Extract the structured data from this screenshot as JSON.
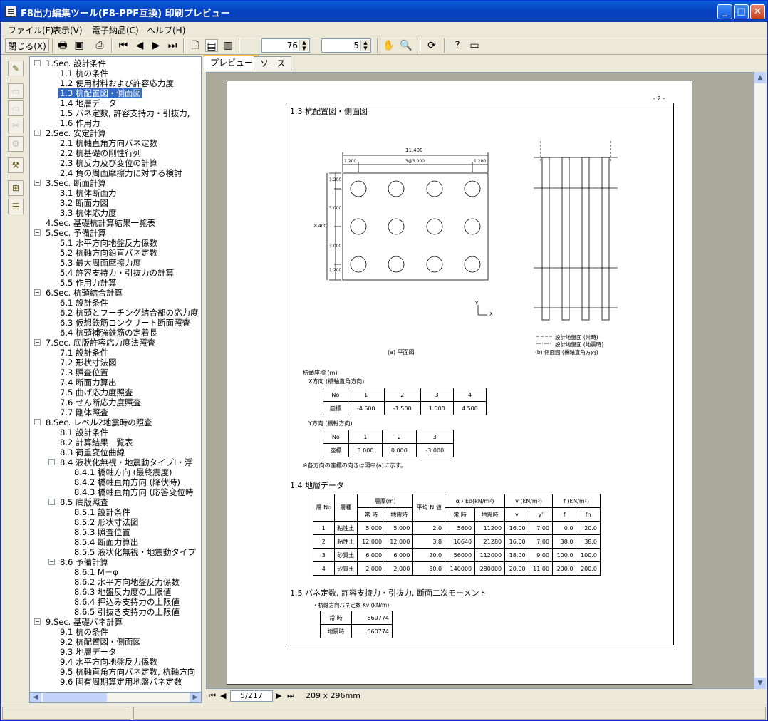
{
  "window": {
    "title": "F8出力編集ツール(F8-PPF互換) 印刷プレビュー",
    "min": "_",
    "max": "□",
    "close": "✕"
  },
  "menu": [
    "ファイル(F)",
    "表示(V)",
    "電子納品(C)",
    "ヘルプ(H)"
  ],
  "toolbar": {
    "close_label": "閉じる(X)",
    "zoom": "76",
    "pages": "5"
  },
  "tree": [
    {
      "t": "1.Sec. 設計条件",
      "l": 0,
      "e": "-"
    },
    {
      "t": "1.1 杭の条件",
      "l": 1
    },
    {
      "t": "1.2 使用材料および許容応力度",
      "l": 1
    },
    {
      "t": "1.3 杭配置図・側面図",
      "l": 1,
      "s": true
    },
    {
      "t": "1.4 地層データ",
      "l": 1
    },
    {
      "t": "1.5 バネ定数, 許容支持力・引抜力,",
      "l": 1
    },
    {
      "t": "1.6 作用力",
      "l": 1
    },
    {
      "t": "2.Sec. 安定計算",
      "l": 0,
      "e": "-"
    },
    {
      "t": "2.1 杭軸直角方向バネ定数",
      "l": 1
    },
    {
      "t": "2.2 杭基礎の剛性行列",
      "l": 1
    },
    {
      "t": "2.3 杭反力及び変位の計算",
      "l": 1
    },
    {
      "t": "2.4 負の周面摩擦力に対する検討",
      "l": 1
    },
    {
      "t": "3.Sec. 断面計算",
      "l": 0,
      "e": "-"
    },
    {
      "t": "3.1 杭体断面力",
      "l": 1
    },
    {
      "t": "3.2 断面力図",
      "l": 1
    },
    {
      "t": "3.3 杭体応力度",
      "l": 1
    },
    {
      "t": "4.Sec. 基礎杭計算結果一覧表",
      "l": 0
    },
    {
      "t": "5.Sec. 予備計算",
      "l": 0,
      "e": "-"
    },
    {
      "t": "5.1 水平方向地盤反力係数",
      "l": 1
    },
    {
      "t": "5.2 杭軸方向鉛直バネ定数",
      "l": 1
    },
    {
      "t": "5.3 最大周面摩擦力度",
      "l": 1
    },
    {
      "t": "5.4 許容支持力・引抜力の計算",
      "l": 1
    },
    {
      "t": "5.5 作用力計算",
      "l": 1
    },
    {
      "t": "6.Sec. 杭頭結合計算",
      "l": 0,
      "e": "-"
    },
    {
      "t": "6.1 設計条件",
      "l": 1
    },
    {
      "t": "6.2 杭頭とフーチング結合部の応力度",
      "l": 1
    },
    {
      "t": "6.3 仮想鉄筋コンクリート断面照査",
      "l": 1
    },
    {
      "t": "6.4 杭頭補強鉄筋の定着長",
      "l": 1
    },
    {
      "t": "7.Sec. 底版許容応力度法照査",
      "l": 0,
      "e": "-"
    },
    {
      "t": "7.1 設計条件",
      "l": 1
    },
    {
      "t": "7.2 形状寸法図",
      "l": 1
    },
    {
      "t": "7.3 照査位置",
      "l": 1
    },
    {
      "t": "7.4 断面力算出",
      "l": 1
    },
    {
      "t": "7.5 曲げ応力度照査",
      "l": 1
    },
    {
      "t": "7.6 せん断応力度照査",
      "l": 1
    },
    {
      "t": "7.7 剛体照査",
      "l": 1
    },
    {
      "t": "8.Sec. レベル2地震時の照査",
      "l": 0,
      "e": "-"
    },
    {
      "t": "8.1 設計条件",
      "l": 1
    },
    {
      "t": "8.2 計算結果一覧表",
      "l": 1
    },
    {
      "t": "8.3 荷重変位曲線",
      "l": 1
    },
    {
      "t": "8.4 液状化無視・地震動タイプI・浮",
      "l": 1,
      "e": "-"
    },
    {
      "t": "8.4.1 橋軸方向 (最終震度)",
      "l": 2
    },
    {
      "t": "8.4.2 橋軸直角方向 (降伏時)",
      "l": 2
    },
    {
      "t": "8.4.3 橋軸直角方向 (応答変位時",
      "l": 2
    },
    {
      "t": "8.5 底版照査",
      "l": 1,
      "e": "-"
    },
    {
      "t": "8.5.1 設計条件",
      "l": 2
    },
    {
      "t": "8.5.2 形状寸法図",
      "l": 2
    },
    {
      "t": "8.5.3 照査位置",
      "l": 2
    },
    {
      "t": "8.5.4 断面力算出",
      "l": 2
    },
    {
      "t": "8.5.5 液状化無視・地震動タイプ",
      "l": 2
    },
    {
      "t": "8.6 予備計算",
      "l": 1,
      "e": "-"
    },
    {
      "t": "8.6.1 M－φ",
      "l": 2
    },
    {
      "t": "8.6.2 水平方向地盤反力係数",
      "l": 2
    },
    {
      "t": "8.6.3 地盤反力度の上限値",
      "l": 2
    },
    {
      "t": "8.6.4 押込み支持力の上限値",
      "l": 2
    },
    {
      "t": "8.6.5 引抜き支持力の上限値",
      "l": 2
    },
    {
      "t": "9.Sec. 基礎バネ計算",
      "l": 0,
      "e": "-"
    },
    {
      "t": "9.1 杭の条件",
      "l": 1
    },
    {
      "t": "9.2 杭配置図・側面図",
      "l": 1
    },
    {
      "t": "9.3 地層データ",
      "l": 1
    },
    {
      "t": "9.4 水平方向地盤反力係数",
      "l": 1
    },
    {
      "t": "9.5 杭軸直角方向バネ定数, 杭軸方向",
      "l": 1
    },
    {
      "t": "9.6 固有周期算定用地盤バネ定数",
      "l": 1
    }
  ],
  "tabs": [
    "プレビュー",
    "ソース"
  ],
  "nav": {
    "page": "5/217",
    "size": "209 x 296mm"
  },
  "doc": {
    "pageno": "- 2 -",
    "h13": "1.3 杭配置図・側面図",
    "dim_total_w": "11.400",
    "dim_left": "1.200",
    "dim_mid": "3@3.000",
    "dim_right": "1.200",
    "dim_total_h": "8.400",
    "dim_v": [
      "1.200",
      "3.000",
      "3.000",
      "1.200"
    ],
    "axis_x": "X",
    "axis_y": "Y",
    "cap_a": "(a) 平面図",
    "cap_b": "(b) 側面図 (橋軸直角方向)",
    "legend1": "設計地盤面 (常時)",
    "legend2": "設計地盤面 (地震時)",
    "coord_title": "杭頭座標 (m)",
    "x_dir": "X方向 (橋軸直角方向)",
    "x_table": {
      "h": [
        "No",
        "1",
        "2",
        "3",
        "4"
      ],
      "r": [
        "座標",
        "-4.500",
        "-1.500",
        "1.500",
        "4.500"
      ]
    },
    "y_dir": "Y方向 (橋軸方向)",
    "y_table": {
      "h": [
        "No",
        "1",
        "2",
        "3"
      ],
      "r": [
        "座標",
        "3.000",
        "0.000",
        "-3.000"
      ]
    },
    "note": "※各方向の座標の向きは図中(a)に示す。",
    "h14": "1.4 地層データ",
    "soil_head": {
      "no": "層 No",
      "kind": "層種",
      "thick": "層厚(m)",
      "avg_n": "平均 N 値",
      "alpha": "α・Eo(kN/m²)",
      "gamma": "γ (kN/m³)",
      "f": "f (kN/m²)",
      "sub": [
        "常 時",
        "地震時",
        "常 時",
        "地震時",
        "γ",
        "γ'",
        "f",
        "fn"
      ]
    },
    "soil_rows": [
      [
        "1",
        "粘性土",
        "5.000",
        "5.000",
        "2.0",
        "5600",
        "11200",
        "16.00",
        "7.00",
        "0.0",
        "20.0"
      ],
      [
        "2",
        "粘性土",
        "12.000",
        "12.000",
        "3.8",
        "10640",
        "21280",
        "16.00",
        "7.00",
        "38.0",
        "38.0"
      ],
      [
        "3",
        "砂質土",
        "6.000",
        "6.000",
        "20.0",
        "56000",
        "112000",
        "18.00",
        "9.00",
        "100.0",
        "100.0"
      ],
      [
        "4",
        "砂質土",
        "2.000",
        "2.000",
        "50.0",
        "140000",
        "280000",
        "20.00",
        "11.00",
        "200.0",
        "200.0"
      ]
    ],
    "h15": "1.5 バネ定数, 許容支持力・引抜力, 断面二次モーメント",
    "kv_title": "・杭軸方向バネ定数 Kv (kN/m)",
    "kv_rows": [
      [
        "常 時",
        "560774"
      ],
      [
        "地震時",
        "560774"
      ]
    ]
  }
}
